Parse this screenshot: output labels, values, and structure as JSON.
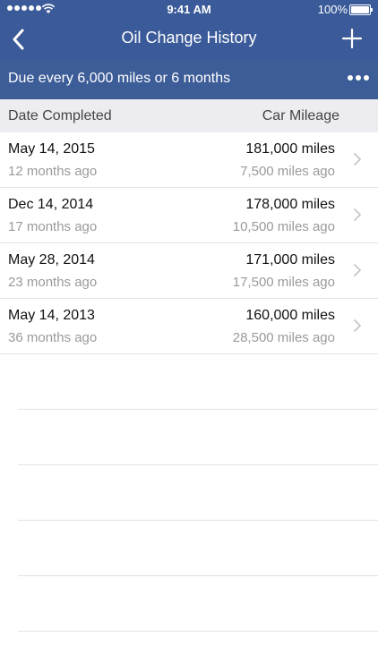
{
  "status_bar": {
    "time": "9:41 AM",
    "battery_percent": "100%"
  },
  "nav": {
    "title": "Oil Change History"
  },
  "banner": {
    "text": "Due every 6,000 miles or 6 months"
  },
  "columns": {
    "left": "Date Completed",
    "right": "Car Mileage"
  },
  "rows": [
    {
      "date": "May 14, 2015",
      "ago": "12 months ago",
      "miles": "181,000 miles",
      "miles_ago": "7,500 miles ago"
    },
    {
      "date": "Dec 14, 2014",
      "ago": "17 months ago",
      "miles": "178,000 miles",
      "miles_ago": "10,500 miles ago"
    },
    {
      "date": "May 28, 2014",
      "ago": "23 months ago",
      "miles": "171,000 miles",
      "miles_ago": "17,500 miles ago"
    },
    {
      "date": "May 14, 2013",
      "ago": "36 months ago",
      "miles": "160,000 miles",
      "miles_ago": "28,500 miles ago"
    }
  ],
  "icons": {
    "back": "chevron-left-icon",
    "add": "plus-icon",
    "more": "ellipsis-icon",
    "row_disclosure": "chevron-right-icon"
  },
  "colors": {
    "header": "#3a5a99",
    "banner": "#3d5d98",
    "column_header_bg": "#ececf1",
    "secondary_text": "#9a9a9a"
  }
}
